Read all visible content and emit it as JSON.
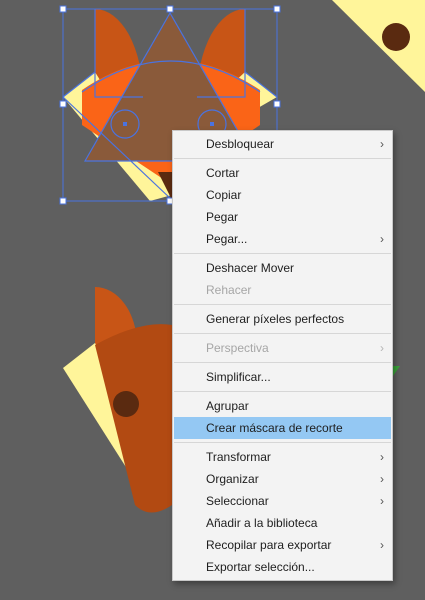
{
  "colors": {
    "canvas_bg": "#5f5f5f",
    "fox_dark": "#c85516",
    "fox_orange": "#fa6417",
    "fox_brown": "#8a5a3a",
    "cream": "#fff59a",
    "eye": "#5a2a10",
    "selection": "#4a73e0",
    "menu_bg": "#f3f3f3",
    "menu_highlight": "#94c8f3",
    "menu_disabled": "#a6a6a6"
  },
  "context_menu": {
    "items": [
      {
        "label": "Desbloquear",
        "submenu": true,
        "disabled": false,
        "highlighted": false
      },
      {
        "separator": true
      },
      {
        "label": "Cortar",
        "submenu": false,
        "disabled": false,
        "highlighted": false
      },
      {
        "label": "Copiar",
        "submenu": false,
        "disabled": false,
        "highlighted": false
      },
      {
        "label": "Pegar",
        "submenu": false,
        "disabled": false,
        "highlighted": false
      },
      {
        "label": "Pegar...",
        "submenu": true,
        "disabled": false,
        "highlighted": false
      },
      {
        "separator": true
      },
      {
        "label": "Deshacer Mover",
        "submenu": false,
        "disabled": false,
        "highlighted": false
      },
      {
        "label": "Rehacer",
        "submenu": false,
        "disabled": true,
        "highlighted": false
      },
      {
        "separator": true
      },
      {
        "label": "Generar píxeles perfectos",
        "submenu": false,
        "disabled": false,
        "highlighted": false
      },
      {
        "separator": true
      },
      {
        "label": "Perspectiva",
        "submenu": true,
        "disabled": true,
        "highlighted": false
      },
      {
        "separator": true
      },
      {
        "label": "Simplificar...",
        "submenu": false,
        "disabled": false,
        "highlighted": false
      },
      {
        "separator": true
      },
      {
        "label": "Agrupar",
        "submenu": false,
        "disabled": false,
        "highlighted": false
      },
      {
        "label": "Crear máscara de recorte",
        "submenu": false,
        "disabled": false,
        "highlighted": true
      },
      {
        "separator": true
      },
      {
        "label": "Transformar",
        "submenu": true,
        "disabled": false,
        "highlighted": false
      },
      {
        "label": "Organizar",
        "submenu": true,
        "disabled": false,
        "highlighted": false
      },
      {
        "label": "Seleccionar",
        "submenu": true,
        "disabled": false,
        "highlighted": false
      },
      {
        "label": "Añadir a la biblioteca",
        "submenu": false,
        "disabled": false,
        "highlighted": false
      },
      {
        "label": "Recopilar para exportar",
        "submenu": true,
        "disabled": false,
        "highlighted": false
      },
      {
        "label": "Exportar selección...",
        "submenu": false,
        "disabled": false,
        "highlighted": false
      }
    ]
  }
}
